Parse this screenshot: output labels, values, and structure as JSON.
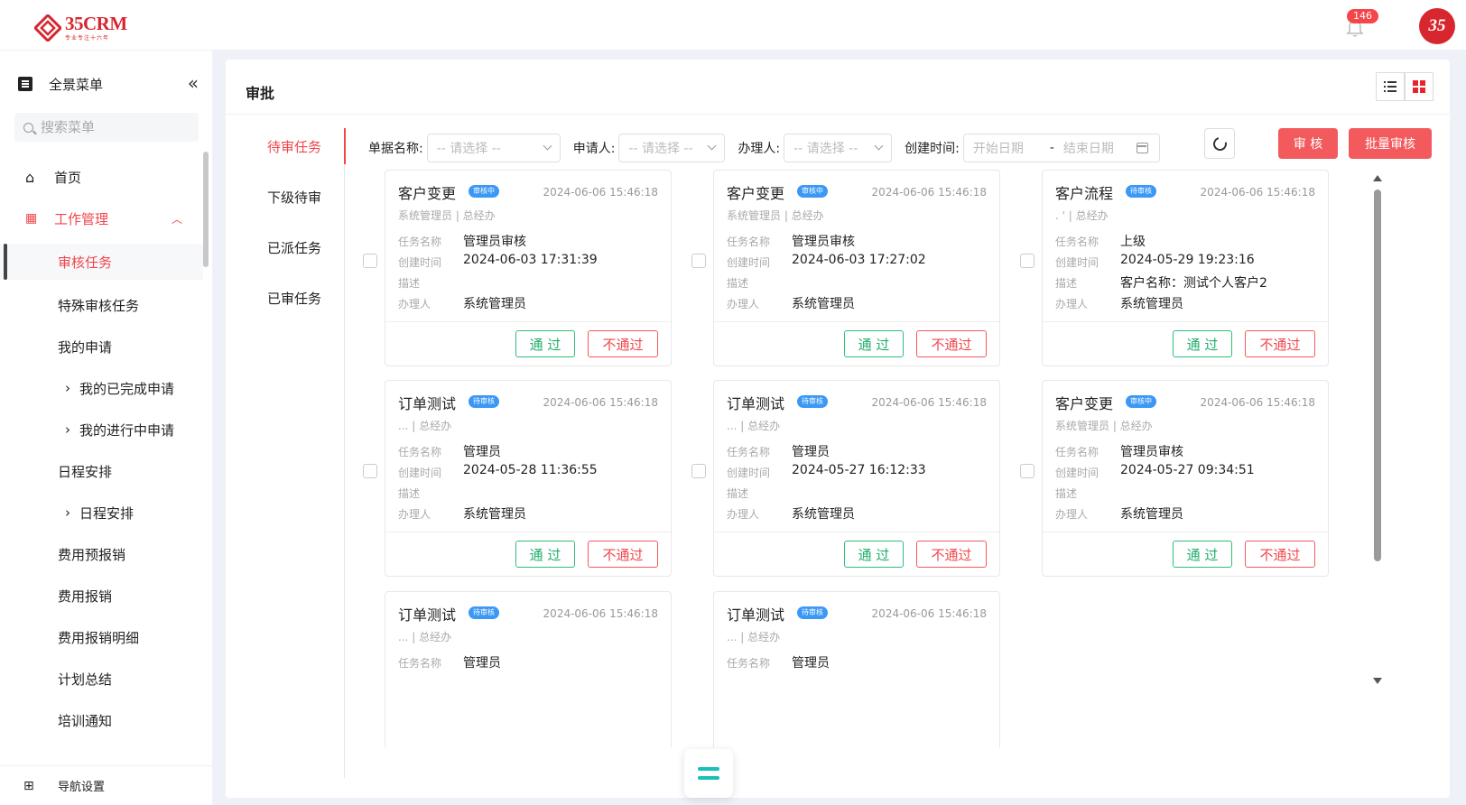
{
  "header": {
    "logo_text": "35CRM",
    "logo_sub": "专业专注十六年",
    "notification_count": "146",
    "avatar_text": "35"
  },
  "sidebar": {
    "menu_title": "全景菜单",
    "search_placeholder": "搜索菜单",
    "items": [
      {
        "label": "首页"
      },
      {
        "label": "工作管理"
      },
      {
        "label": "审核任务"
      },
      {
        "label": "特殊审核任务"
      },
      {
        "label": "我的申请"
      },
      {
        "label": "我的已完成申请"
      },
      {
        "label": "我的进行中申请"
      },
      {
        "label": "日程安排"
      },
      {
        "label": "日程安排"
      },
      {
        "label": "费用预报销"
      },
      {
        "label": "费用报销"
      },
      {
        "label": "费用报销明细"
      },
      {
        "label": "计划总结"
      },
      {
        "label": "培训通知"
      }
    ],
    "nav_setting": "导航设置"
  },
  "main": {
    "title": "审批",
    "tabs": [
      {
        "label": "待审任务"
      },
      {
        "label": "下级待审"
      },
      {
        "label": "已派任务"
      },
      {
        "label": "已审任务"
      }
    ],
    "filters": {
      "doc_name_label": "单据名称:",
      "doc_name_placeholder": "-- 请选择 --",
      "applicant_label": "申请人:",
      "applicant_placeholder": "-- 请选择 --",
      "handler_label": "办理人:",
      "handler_placeholder": "-- 请选择 --",
      "created_label": "创建时间:",
      "start_placeholder": "开始日期",
      "range_sep": "-",
      "end_placeholder": "结束日期"
    },
    "audit_button": "审 核",
    "batch_audit_button": "批量审核"
  },
  "card_labels": {
    "task_name": "任务名称",
    "created_time": "创建时间",
    "description": "描述",
    "handler": "办理人",
    "pass": "通 过",
    "reject": "不通过"
  },
  "cards": [
    {
      "title": "客户变更",
      "tag": "审核中",
      "date": "2024-06-06 15:46:18",
      "sub": "系统管理员 | 总经办",
      "task_name": "管理员审核",
      "created": "2024-06-03 17:31:39",
      "desc": "",
      "handler": "系统管理员"
    },
    {
      "title": "客户变更",
      "tag": "审核中",
      "date": "2024-06-06 15:46:18",
      "sub": "系统管理员 | 总经办",
      "task_name": "管理员审核",
      "created": "2024-06-03 17:27:02",
      "desc": "",
      "handler": "系统管理员"
    },
    {
      "title": "客户流程",
      "tag": "待审核",
      "date": "2024-06-06 15:46:18",
      "sub": ". ' | 总经办",
      "task_name": "上级",
      "created": "2024-05-29 19:23:16",
      "desc": "客户名称：测试个人客户2",
      "handler": "系统管理员"
    },
    {
      "title": "订单测试",
      "tag": "待审核",
      "date": "2024-06-06 15:46:18",
      "sub": "... | 总经办",
      "task_name": "管理员",
      "created": "2024-05-28 11:36:55",
      "desc": "",
      "handler": "系统管理员"
    },
    {
      "title": "订单测试",
      "tag": "待审核",
      "date": "2024-06-06 15:46:18",
      "sub": "... | 总经办",
      "task_name": "管理员",
      "created": "2024-05-27 16:12:33",
      "desc": "",
      "handler": "系统管理员"
    },
    {
      "title": "客户变更",
      "tag": "审核中",
      "date": "2024-06-06 15:46:18",
      "sub": "系统管理员 | 总经办",
      "task_name": "管理员审核",
      "created": "2024-05-27 09:34:51",
      "desc": "",
      "handler": "系统管理员"
    },
    {
      "title": "订单测试",
      "tag": "待审核",
      "date": "2024-06-06 15:46:18",
      "sub": "... | 总经办",
      "task_name": "管理员",
      "created": "",
      "desc": "",
      "handler": ""
    },
    {
      "title": "订单测试",
      "tag": "待审核",
      "date": "2024-06-06 15:46:18",
      "sub": "... | 总经办",
      "task_name": "管理员",
      "created": "",
      "desc": "",
      "handler": ""
    }
  ],
  "colors": {
    "accent_red": "#f0464b",
    "pass_green": "#1fae6a",
    "tag_blue": "#3b98f5",
    "float_teal": "#17c1b5"
  }
}
